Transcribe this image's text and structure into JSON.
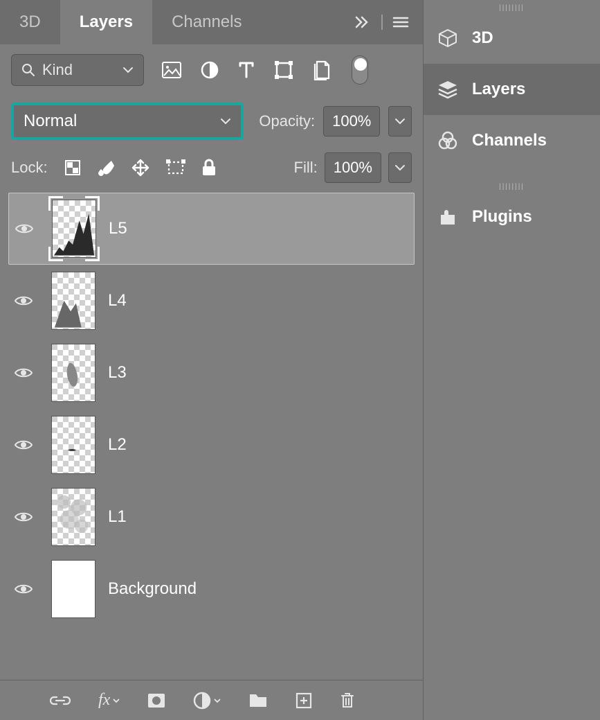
{
  "tabs": {
    "d3d": "3D",
    "layers": "Layers",
    "channels": "Channels"
  },
  "filter": {
    "kind": "Kind"
  },
  "blend": {
    "mode": "Normal"
  },
  "opacity": {
    "label": "Opacity:",
    "value": "100%"
  },
  "lock": {
    "label": "Lock:"
  },
  "fill": {
    "label": "Fill:",
    "value": "100%"
  },
  "layers": [
    {
      "name": "L5"
    },
    {
      "name": "L4"
    },
    {
      "name": "L3"
    },
    {
      "name": "L2"
    },
    {
      "name": "L1"
    },
    {
      "name": "Background"
    }
  ],
  "dock": {
    "d3d": "3D",
    "layers": "Layers",
    "channels": "Channels",
    "plugins": "Plugins"
  }
}
